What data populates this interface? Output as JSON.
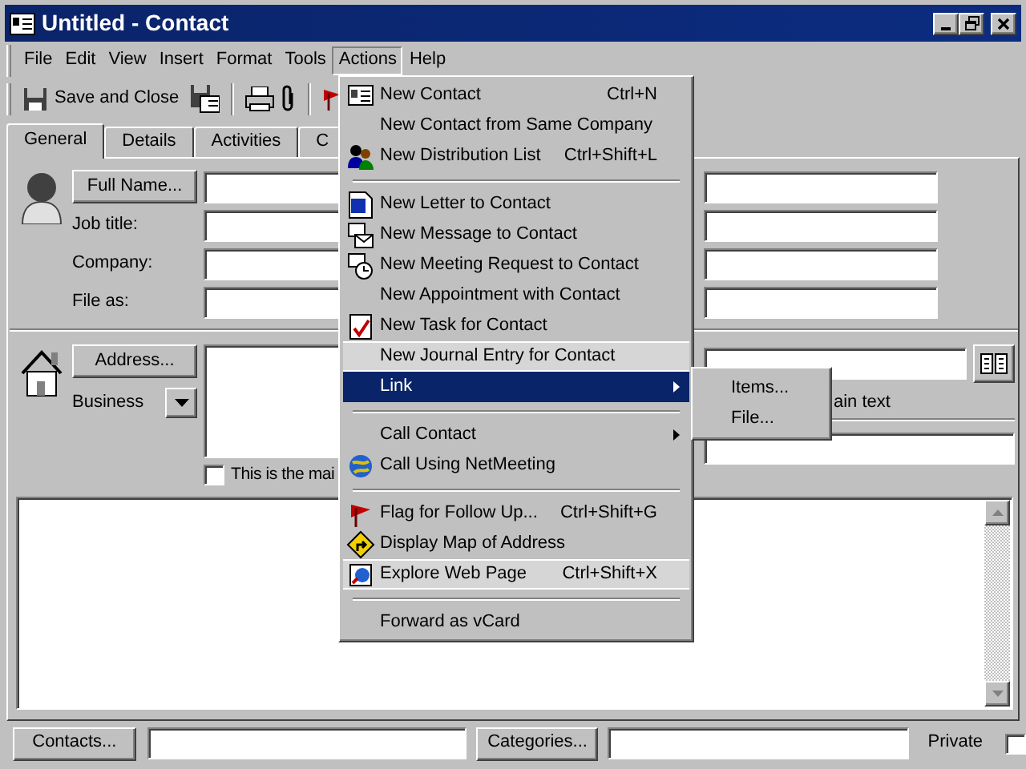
{
  "window": {
    "title": "Untitled - Contact"
  },
  "menu_bar": [
    {
      "label": "File",
      "selected": false
    },
    {
      "label": "Edit",
      "selected": false
    },
    {
      "label": "View",
      "selected": false
    },
    {
      "label": "Insert",
      "selected": false
    },
    {
      "label": "Format",
      "selected": false
    },
    {
      "label": "Tools",
      "selected": false
    },
    {
      "label": "Actions",
      "selected": true
    },
    {
      "label": "Help",
      "selected": false
    }
  ],
  "toolbar": {
    "save_and_close": "Save and Close"
  },
  "tabs": [
    {
      "label": "General",
      "selected": true
    },
    {
      "label": "Details",
      "selected": false
    },
    {
      "label": "Activities",
      "selected": false
    },
    {
      "label": "C",
      "selected": false
    }
  ],
  "general": {
    "full_name_button": "Full Name...",
    "job_title_label": "Job title:",
    "company_label": "Company:",
    "file_as_label": "File as:",
    "address_button": "Address...",
    "address_type": "Business",
    "mailing_address": {
      "label": "This is the mai",
      "checked": false
    },
    "plain_text_label": "ain text"
  },
  "footer": {
    "contacts_button": "Contacts...",
    "categories_button": "Categories...",
    "private": {
      "label": "Private",
      "checked": false
    }
  },
  "actions_menu": [
    {
      "kind": "item",
      "label": "New Contact",
      "shortcut": "Ctrl+N",
      "selected": false,
      "rarely_used": false
    },
    {
      "kind": "item",
      "label": "New Contact from Same Company",
      "selected": false,
      "rarely_used": false
    },
    {
      "kind": "item",
      "label": "New Distribution List",
      "shortcut": "Ctrl+Shift+L",
      "selected": false,
      "rarely_used": false
    },
    {
      "kind": "separator"
    },
    {
      "kind": "item",
      "label": "New Letter to Contact",
      "selected": false,
      "rarely_used": false
    },
    {
      "kind": "item",
      "label": "New Message to Contact",
      "selected": false,
      "rarely_used": false
    },
    {
      "kind": "item",
      "label": "New Meeting Request to Contact",
      "selected": false,
      "rarely_used": false
    },
    {
      "kind": "item",
      "label": "New Appointment with Contact",
      "selected": false,
      "rarely_used": false
    },
    {
      "kind": "item",
      "label": "New Task for Contact",
      "selected": false,
      "rarely_used": false
    },
    {
      "kind": "item",
      "label": "New Journal Entry for Contact",
      "selected": false,
      "rarely_used": true
    },
    {
      "kind": "item",
      "label": "Link",
      "selected": true,
      "rarely_used": false,
      "submenu": true
    },
    {
      "kind": "separator"
    },
    {
      "kind": "item",
      "label": "Call Contact",
      "selected": false,
      "rarely_used": false,
      "submenu": true
    },
    {
      "kind": "item",
      "label": "Call Using NetMeeting",
      "selected": false,
      "rarely_used": false
    },
    {
      "kind": "separator"
    },
    {
      "kind": "item",
      "label": "Flag for Follow Up...",
      "shortcut": "Ctrl+Shift+G",
      "selected": false,
      "rarely_used": false
    },
    {
      "kind": "item",
      "label": "Display Map of Address",
      "selected": false,
      "rarely_used": false
    },
    {
      "kind": "item",
      "label": "Explore Web Page",
      "shortcut": "Ctrl+Shift+X",
      "selected": false,
      "rarely_used": true
    },
    {
      "kind": "separator"
    },
    {
      "kind": "item",
      "label": "Forward as vCard",
      "selected": false,
      "rarely_used": false
    }
  ],
  "link_submenu": [
    {
      "label": "Items...",
      "selected": false
    },
    {
      "label": "File...",
      "selected": false
    }
  ]
}
